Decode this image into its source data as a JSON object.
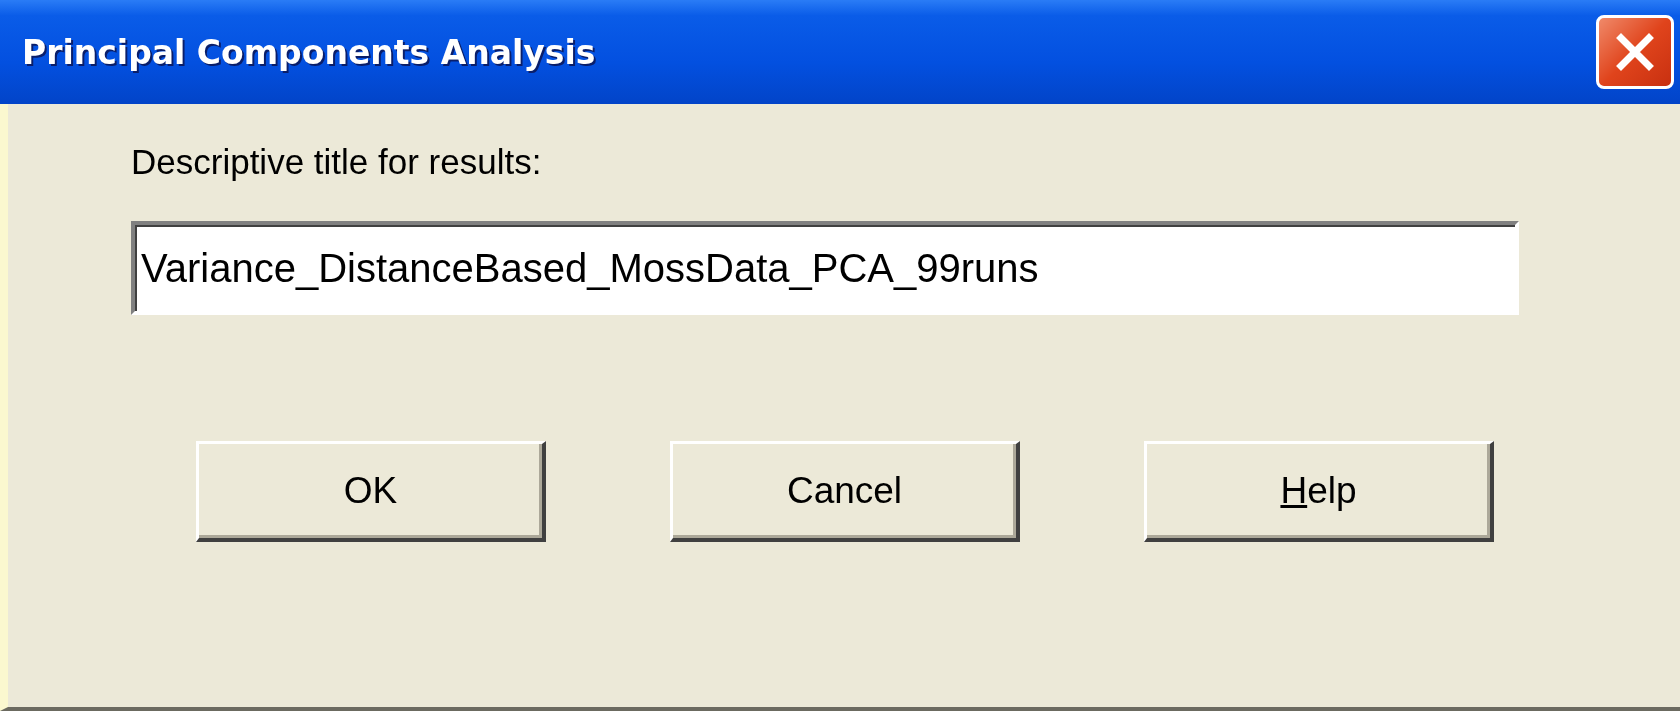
{
  "window": {
    "title": "Principal Components Analysis"
  },
  "title_field": {
    "label": "Descriptive title for results:",
    "value": "Variance_DistanceBased_MossData_PCA_99runs"
  },
  "buttons": [
    {
      "label": "OK",
      "underlined_first_letter": false
    },
    {
      "label": "Cancel",
      "underlined_first_letter": false
    },
    {
      "label": "Help",
      "underlined_first_letter": true
    }
  ]
}
